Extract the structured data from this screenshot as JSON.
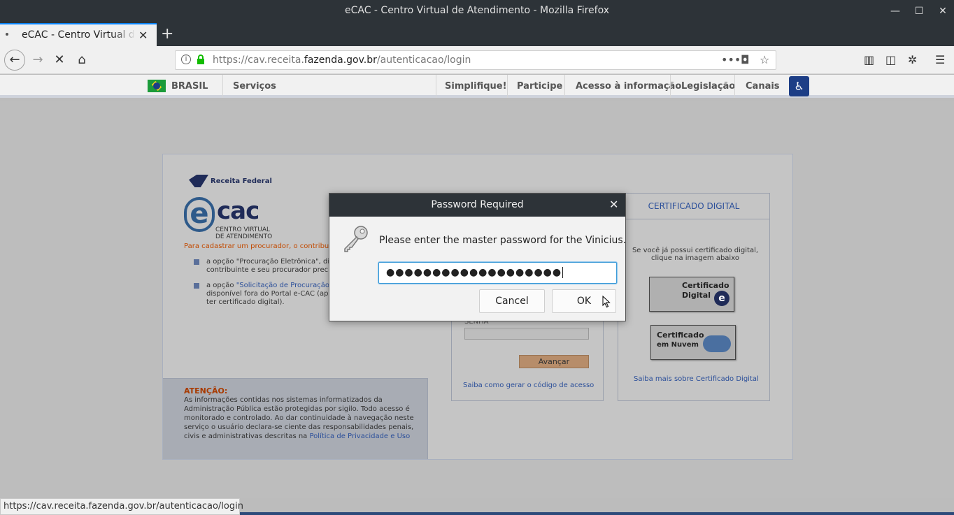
{
  "window": {
    "title": "eCAC - Centro Virtual de Atendimento - Mozilla Firefox"
  },
  "tabs": [
    {
      "label": "eCAC - Centro Virtual de Atendimento"
    }
  ],
  "nav": {
    "url_prefix": "https://cav.receita.",
    "url_domain": "fazenda.gov.br",
    "url_suffix": "/autenticacao/login"
  },
  "govbar": {
    "brasil": "BRASIL",
    "servicos": "Serviços",
    "simplifique": "Simplifique!",
    "participe": "Participe",
    "acesso": "Acesso à informação",
    "legislacao": "Legislação",
    "canais": "Canais"
  },
  "page": {
    "rf_logo": "Receita Federal",
    "ecac_e": "e",
    "ecac_cac": "cac",
    "ecac_sub1": "CENTRO VIRTUAL",
    "ecac_sub2": "DE ATENDIMENTO",
    "procurador": "Para cadastrar um procurador, o contribuinte",
    "bullet1_prefix": "a opção \"Procuração Eletrônica\", dis",
    "bullet1_line2": "contribuinte e seu procurador precis",
    "bullet2_prefix": "a opção ",
    "bullet2_link": "\"Solicitação de Procuração",
    "bullet2_line2": "disponível fora do Portal e-CAC (ape",
    "bullet2_line3": "ter certificado digital).",
    "atencao_title": "ATENÇÃO:",
    "atencao_text": "As informações contidas nos sistemas informatizados da Administração Pública estão protegidas por sigilo. Todo acesso é monitorado e controlado. Ao dar continuidade à navegação neste serviço o usuário declara-se ciente das responsabilidades penais, civis e administrativas descritas na ",
    "atencao_link": "Política de Privacidade e Uso",
    "senha_label": "SENHA",
    "avancar": "Avançar",
    "saiba_codigo": "Saiba como gerar o código de acesso",
    "cert_header": "CERTIFICADO DIGITAL",
    "cert_text": "Se você já possui certificado digital, clique na imagem abaixo",
    "cert_digital_1": "Certificado",
    "cert_digital_2": "Digital",
    "cert_nuvem_1": "Certificado",
    "cert_nuvem_2": "em Nuvem",
    "saiba_cert": "Saiba mais sobre Certificado Digital"
  },
  "dialog": {
    "title": "Password Required",
    "message": "Please enter the master password for the Vinicius.",
    "password_value": "●●●●●●●●●●●●●●●●●●●",
    "cancel": "Cancel",
    "ok": "OK"
  },
  "statusbar": {
    "text": "https://cav.receita.fazenda.gov.br/autenticacao/login"
  },
  "colors": {
    "chrome_dark": "#2d3338",
    "accent_blue": "#0a84ff",
    "link_blue": "#2b4f9a",
    "warning_orange": "#c24a00"
  }
}
